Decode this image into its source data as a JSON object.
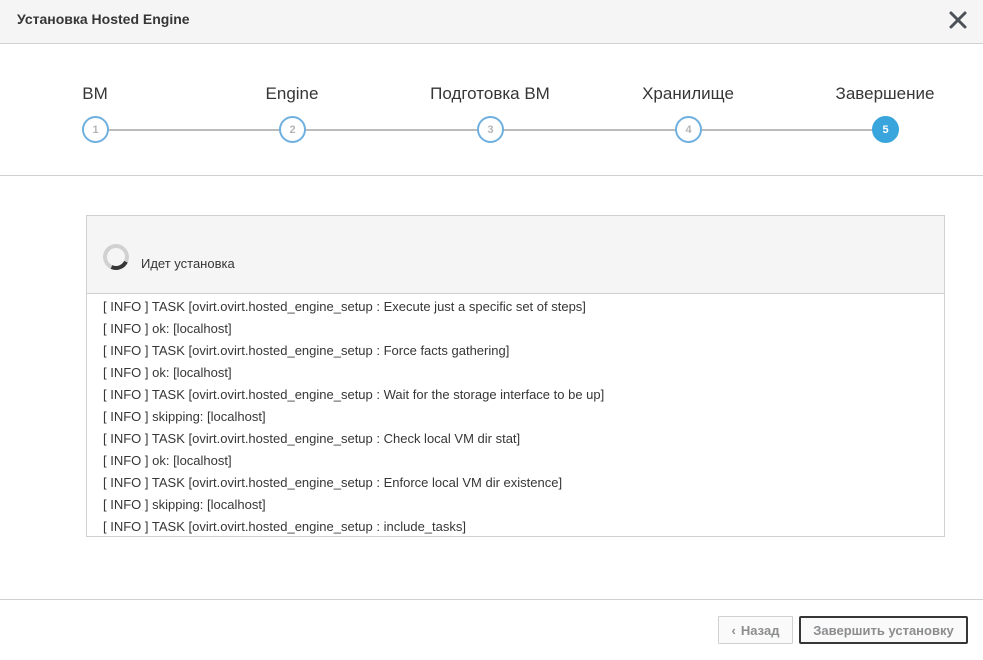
{
  "header": {
    "title": "Установка Hosted Engine",
    "close_icon": "close-icon"
  },
  "wizard": {
    "steps": [
      {
        "label": "ВМ",
        "number": "1",
        "state": "done"
      },
      {
        "label": "Engine",
        "number": "2",
        "state": "done"
      },
      {
        "label": "Подготовка ВМ",
        "number": "3",
        "state": "done"
      },
      {
        "label": "Хранилище",
        "number": "4",
        "state": "done"
      },
      {
        "label": "Завершение",
        "number": "5",
        "state": "active"
      }
    ],
    "colors": {
      "active": "#39a5dc",
      "done_border": "#6fb0e0",
      "line": "#bbbbbb"
    }
  },
  "progress": {
    "status": "Идет установка",
    "spinner_icon": "spinner-icon",
    "log": [
      "[ INFO ] TASK [ovirt.ovirt.hosted_engine_setup : Execute just a specific set of steps]",
      "[ INFO ] ok: [localhost]",
      "[ INFO ] TASK [ovirt.ovirt.hosted_engine_setup : Force facts gathering]",
      "[ INFO ] ok: [localhost]",
      "[ INFO ] TASK [ovirt.ovirt.hosted_engine_setup : Wait for the storage interface to be up]",
      "[ INFO ] skipping: [localhost]",
      "[ INFO ] TASK [ovirt.ovirt.hosted_engine_setup : Check local VM dir stat]",
      "[ INFO ] ok: [localhost]",
      "[ INFO ] TASK [ovirt.ovirt.hosted_engine_setup : Enforce local VM dir existence]",
      "[ INFO ] skipping: [localhost]",
      "[ INFO ] TASK [ovirt.ovirt.hosted_engine_setup : include_tasks]"
    ]
  },
  "footer": {
    "back_label": "Назад",
    "back_icon": "chevron-left-icon",
    "finish_label": "Завершить установку"
  }
}
